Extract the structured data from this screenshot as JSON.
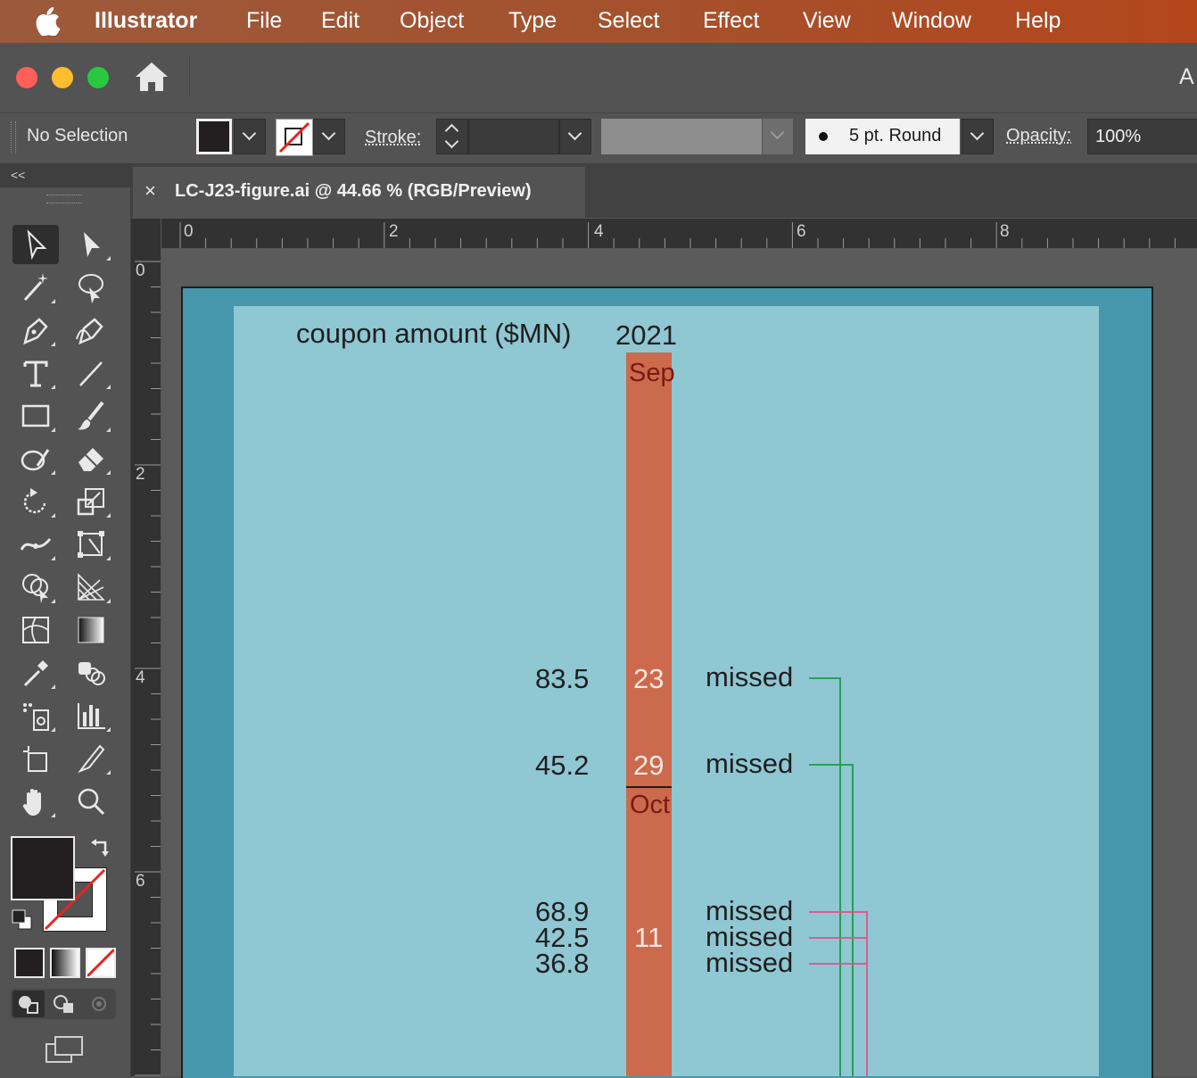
{
  "menu_bar": {
    "app_name": "Illustrator",
    "items": [
      "File",
      "Edit",
      "Object",
      "Type",
      "Select",
      "Effect",
      "View",
      "Window",
      "Help"
    ]
  },
  "app_header": {
    "right_text": "A"
  },
  "control_bar": {
    "selection_label": "No Selection",
    "stroke_label": "Stroke:",
    "brush_label": "5 pt. Round",
    "opacity_label": "Opacity:",
    "opacity_value": "100%"
  },
  "document": {
    "tab_title": "LC-J23-figure.ai @ 44.66 % (RGB/Preview)",
    "close_glyph": "×"
  },
  "rulers": {
    "horizontal": [
      "0",
      "2",
      "4",
      "6",
      "8"
    ],
    "vertical": [
      "0",
      "2",
      "4",
      "6"
    ]
  },
  "toolbar": {
    "collapse_glyph": "<<"
  },
  "artwork": {
    "title": "coupon amount ($MN)",
    "year": "2021",
    "bar_color": "#cc6a4e",
    "month_labels": [
      "Sep",
      "Oct"
    ],
    "rows": [
      {
        "amount": "83.5",
        "day": "23",
        "status": "missed"
      },
      {
        "amount": "45.2",
        "day": "29",
        "status": "missed"
      },
      {
        "amount": "68.9",
        "day": "",
        "status": "missed"
      },
      {
        "amount": "42.5",
        "day": "11",
        "status": "missed"
      },
      {
        "amount": "36.8",
        "day": "",
        "status": "missed"
      }
    ],
    "connector_colors": {
      "green": "#1f9a45",
      "pink": "#e0508a"
    }
  }
}
